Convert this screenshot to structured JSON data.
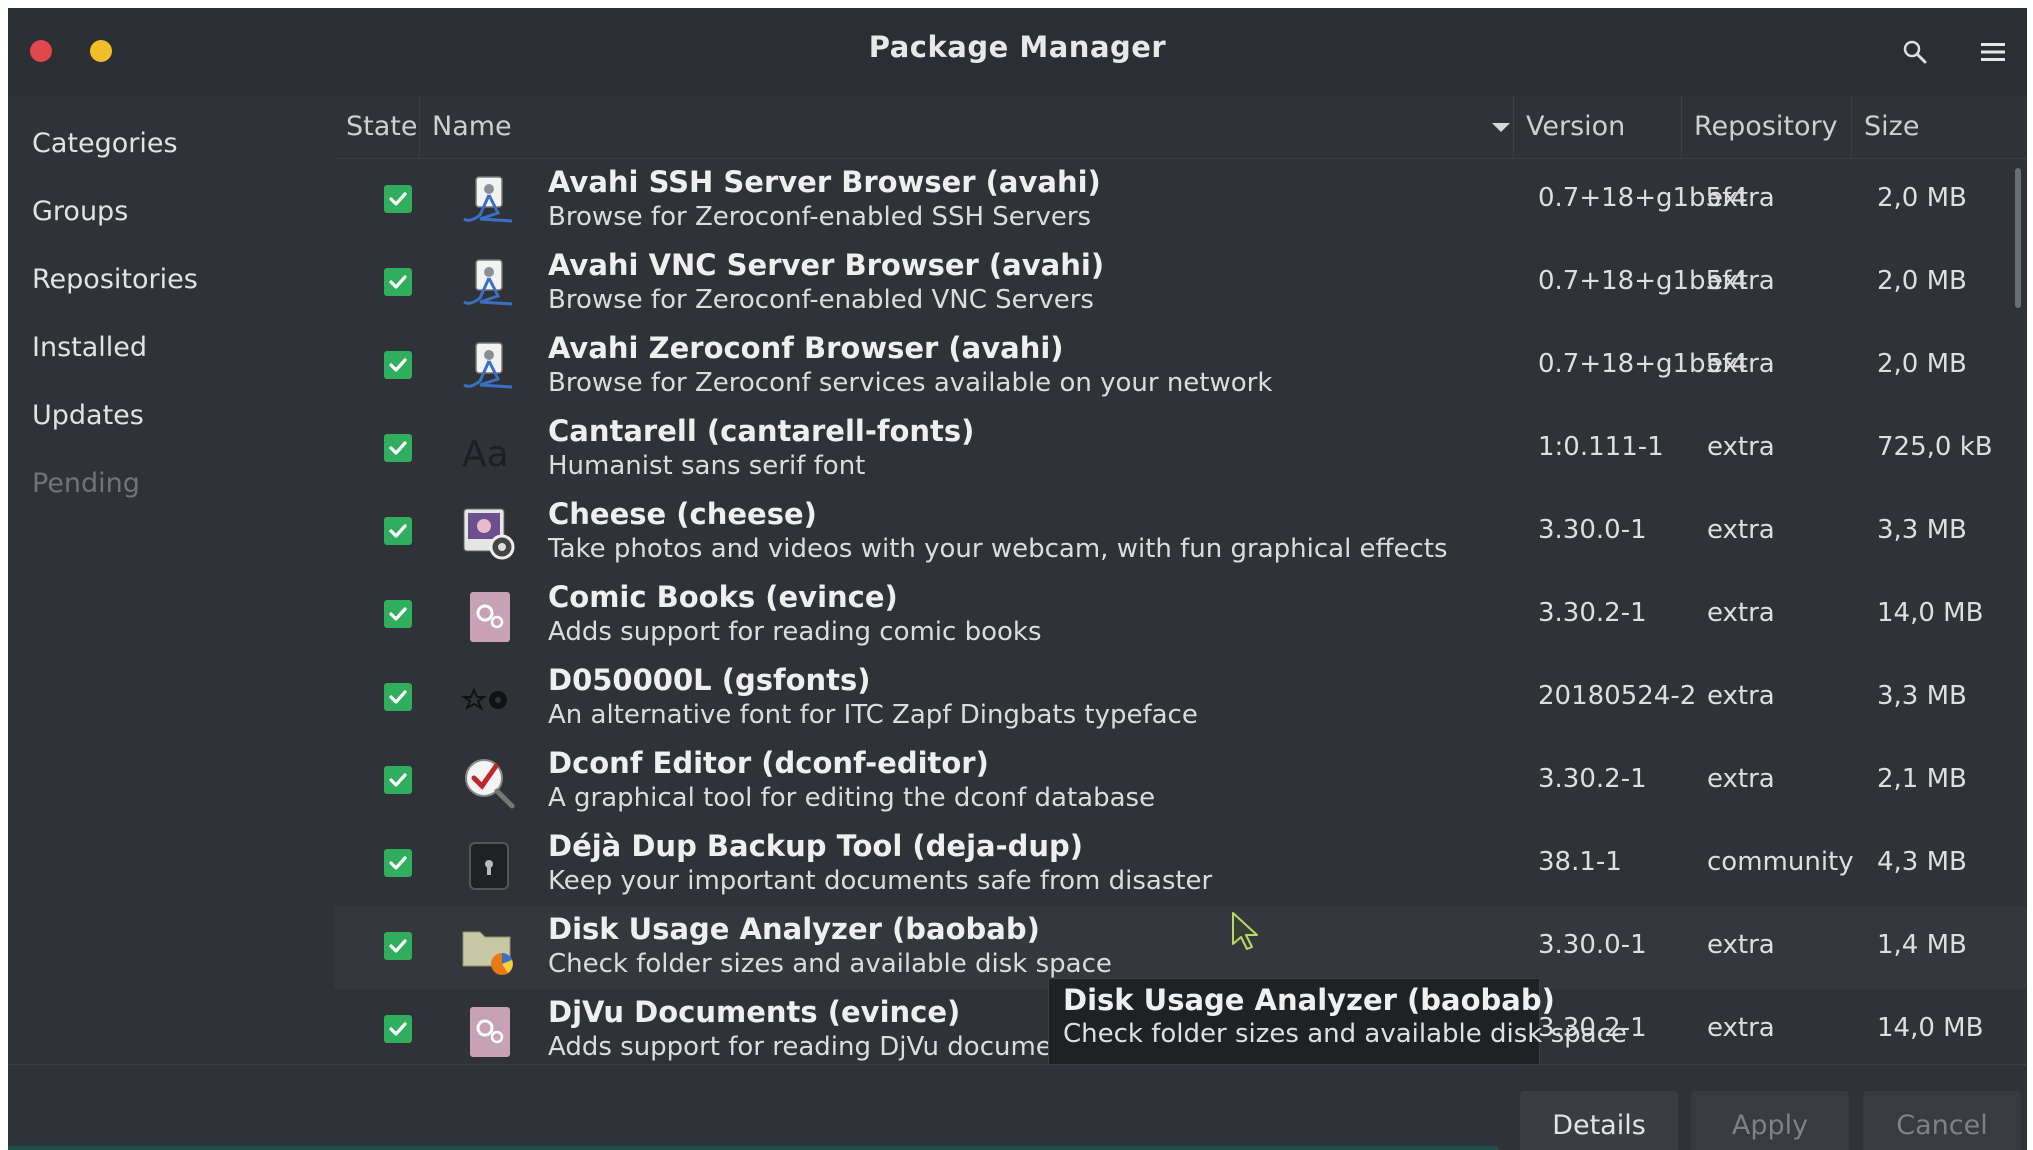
{
  "window": {
    "title": "Package Manager"
  },
  "sidebar": {
    "items": [
      {
        "label": "Categories"
      },
      {
        "label": "Groups"
      },
      {
        "label": "Repositories"
      },
      {
        "label": "Installed"
      },
      {
        "label": "Updates"
      },
      {
        "label": "Pending",
        "disabled": true
      }
    ]
  },
  "table": {
    "columns": {
      "state": "State",
      "name": "Name",
      "version": "Version",
      "repository": "Repository",
      "size": "Size"
    },
    "rows": [
      {
        "name": "Avahi SSH Server Browser  (avahi)",
        "desc": "Browse for Zeroconf-enabled SSH Servers",
        "version": "0.7+18+g1b5f4",
        "repo": "extra",
        "size": "2,0 MB",
        "icon": "network-browser-icon"
      },
      {
        "name": "Avahi VNC Server Browser  (avahi)",
        "desc": "Browse for Zeroconf-enabled VNC Servers",
        "version": "0.7+18+g1b5f4",
        "repo": "extra",
        "size": "2,0 MB",
        "icon": "network-browser-icon"
      },
      {
        "name": "Avahi Zeroconf Browser  (avahi)",
        "desc": "Browse for Zeroconf services available on your network",
        "version": "0.7+18+g1b5f4",
        "repo": "extra",
        "size": "2,0 MB",
        "icon": "network-browser-icon"
      },
      {
        "name": "Cantarell  (cantarell-fonts)",
        "desc": "Humanist sans serif font",
        "version": "1:0.111-1",
        "repo": "extra",
        "size": "725,0 kB",
        "icon": "font-icon",
        "icon_text": "Aa"
      },
      {
        "name": "Cheese  (cheese)",
        "desc": "Take photos and videos with your webcam, with fun graphical effects",
        "version": "3.30.0-1",
        "repo": "extra",
        "size": "3,3 MB",
        "icon": "webcam-icon"
      },
      {
        "name": "Comic Books  (evince)",
        "desc": "Adds support for reading comic books",
        "version": "3.30.2-1",
        "repo": "extra",
        "size": "14,0 MB",
        "icon": "plugin-gear-icon"
      },
      {
        "name": "D050000L  (gsfonts)",
        "desc": "An alternative font for ITC Zapf Dingbats typeface",
        "version": "20180524-2",
        "repo": "extra",
        "size": "3,3 MB",
        "icon": "dingbats-font-icon"
      },
      {
        "name": "Dconf Editor  (dconf-editor)",
        "desc": "A graphical tool for editing the dconf database",
        "version": "3.30.2-1",
        "repo": "extra",
        "size": "2,1 MB",
        "icon": "dconf-editor-icon"
      },
      {
        "name": "Déjà Dup Backup Tool  (deja-dup)",
        "desc": "Keep your important documents safe from disaster",
        "version": "38.1-1",
        "repo": "community",
        "size": "4,3 MB",
        "icon": "backup-safe-icon"
      },
      {
        "name": "Disk Usage Analyzer  (baobab)",
        "desc": "Check folder sizes and available disk space",
        "version": "3.30.0-1",
        "repo": "extra",
        "size": "1,4 MB",
        "icon": "disk-usage-folder-icon"
      },
      {
        "name": "DjVu Documents  (evince)",
        "desc": "Adds support for reading DjVu documents",
        "version": "3.30.2-1",
        "repo": "extra",
        "size": "14,0 MB",
        "icon": "plugin-gear-icon"
      }
    ]
  },
  "tooltip": {
    "title": "Disk Usage Analyzer  (baobab)",
    "desc": "Check folder sizes and available disk space"
  },
  "buttons": {
    "details": "Details",
    "apply": "Apply",
    "cancel": "Cancel"
  },
  "colors": {
    "check_green": "#2fae5e",
    "close_red": "#e0484c",
    "minimize_yellow": "#f0be27"
  }
}
